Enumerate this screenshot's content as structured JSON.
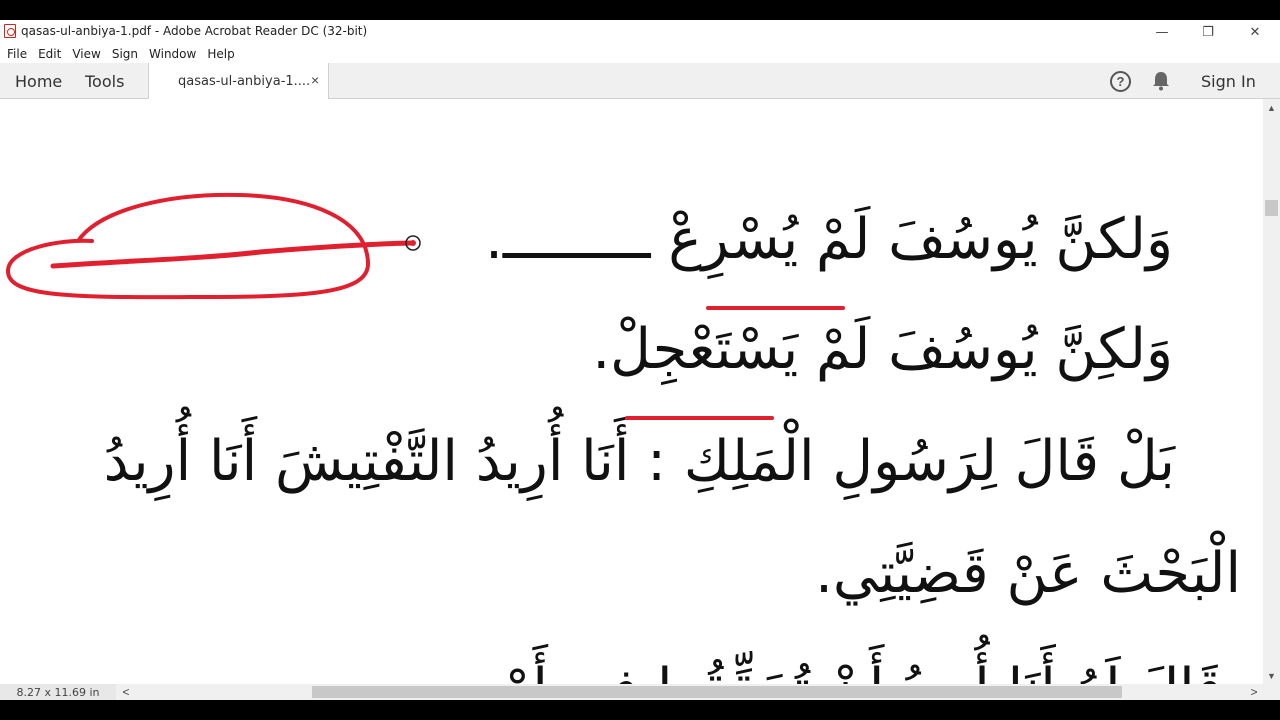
{
  "window": {
    "title": "qasas-ul-anbiya-1.pdf - Adobe Acrobat Reader DC (32-bit)",
    "minimize": "—",
    "restore": "❐",
    "close": "✕"
  },
  "menu": [
    "File",
    "Edit",
    "View",
    "Sign",
    "Window",
    "Help"
  ],
  "tabs": {
    "home": "Home",
    "tools": "Tools",
    "document": "qasas-ul-anbiya-1....",
    "document_close": "×",
    "help": "?",
    "sign_in": "Sign In"
  },
  "document": {
    "lines": [
      "وَلكنَّ يُوسُفَ لَمْ يُسْرِعْ ـــــــــ.",
      "وَلكِنَّ يُوسُفَ لَمْ يَسْتَعْجِلْ.",
      "بَلْ قَالَ لِرَسُولِ الْمَلِكِ : أَنَا أُرِيدُ التَّفْتِيشَ أَنَا أُرِيدُ",
      "الْبَحْثَ عَنْ قَضِيَّتِي.",
      "قَالَ لَهُ أَنَا أُرِيدُ أَنْ تُحَقِّقُوا فِي أَمْرِي"
    ]
  },
  "annotation_color": "#e0202f",
  "status": {
    "page_size": "8.27 x 11.69 in"
  },
  "scroll": {
    "up": "▲",
    "down": "▼",
    "left": "<",
    "right": ">"
  }
}
